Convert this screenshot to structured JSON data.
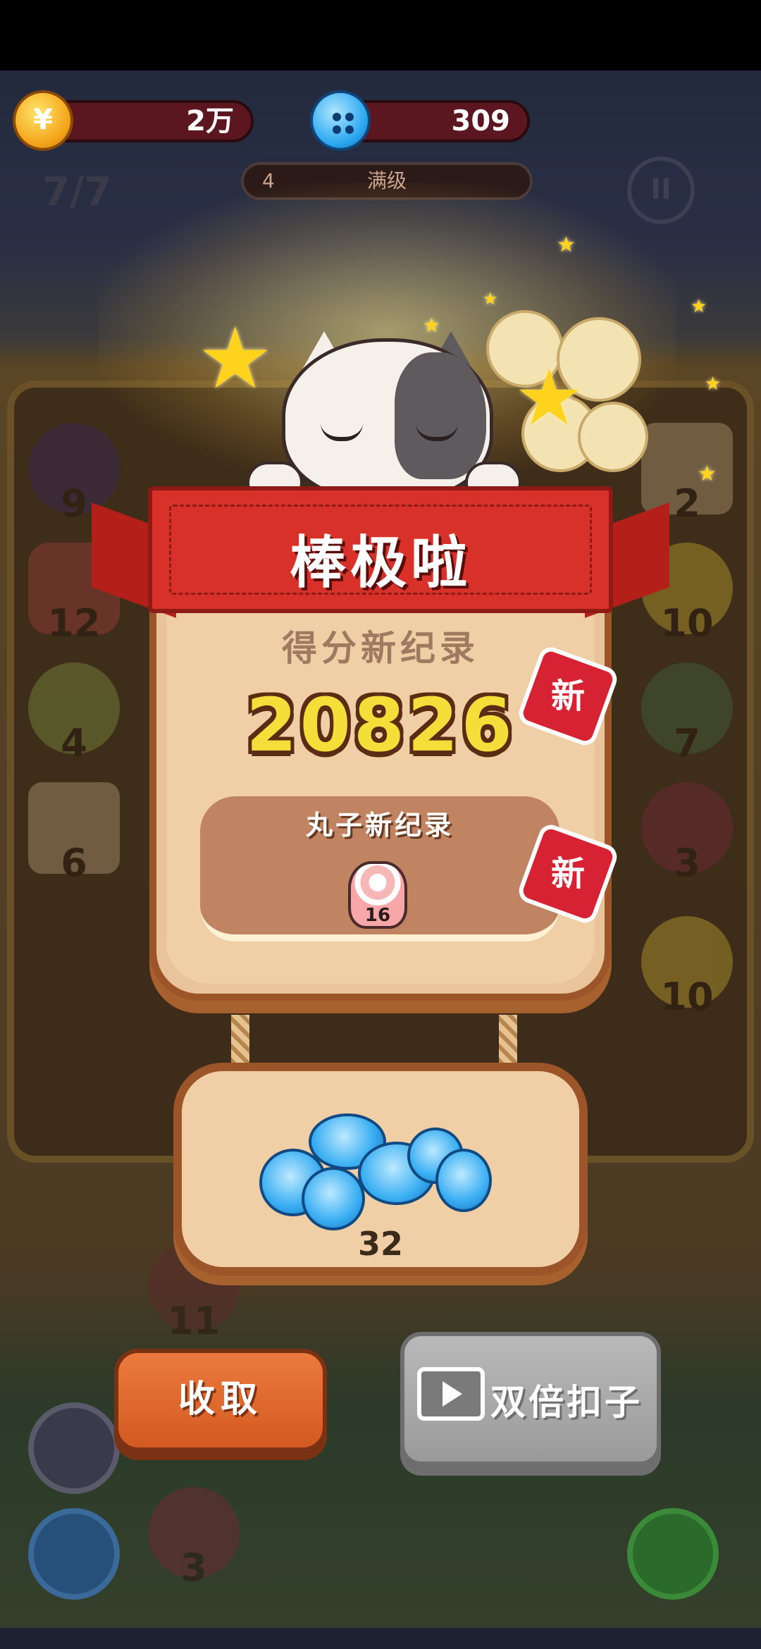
{
  "hud": {
    "coins": "2万",
    "buttons": "309",
    "level_num": "4",
    "level_text": "满级",
    "moves": "7/7",
    "coin_symbol": "¥"
  },
  "board": {
    "left_values": [
      "9",
      "12",
      "4",
      "6"
    ],
    "right_values": [
      "2",
      "10",
      "7",
      "3",
      "10"
    ],
    "lower_values": [
      "11",
      "3"
    ]
  },
  "dialog": {
    "title": "棒极啦",
    "record_label": "得分新纪录",
    "score": "20826",
    "ball_record_label": "丸子新纪录",
    "ball_value": "16",
    "new_badge": "新"
  },
  "reward": {
    "amount": "32"
  },
  "actions": {
    "collect": "收取",
    "double": "双倍扣子"
  },
  "colors": {
    "accent_orange": "#d35a22",
    "ribbon_red": "#d8312a",
    "score_yellow": "#f4de3a",
    "button_blue": "#39aef2"
  }
}
